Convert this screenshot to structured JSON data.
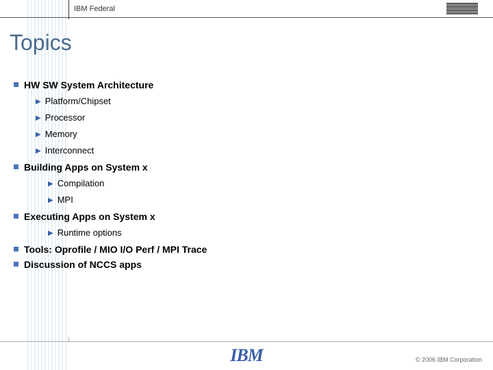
{
  "header": {
    "label": "IBM Federal",
    "logo_alt": "IBM"
  },
  "title": "Topics",
  "topics": [
    {
      "label": "HW SW System Architecture",
      "indent": 1,
      "subs": [
        "Platform/Chipset",
        "Processor",
        "Memory",
        "Interconnect"
      ]
    },
    {
      "label": "Building Apps on System x",
      "indent": 2,
      "subs": [
        "Compilation",
        "MPI"
      ]
    },
    {
      "label": "Executing Apps on System x",
      "indent": 2,
      "subs": [
        "Runtime options"
      ]
    },
    {
      "label": "Tools: Oprofile / MIO I/O Perf / MPI Trace",
      "subs": []
    },
    {
      "label": "Discussion of NCCS apps",
      "subs": []
    }
  ],
  "footer": {
    "logo": "IBM",
    "copyright": "© 2006 IBM Corporation"
  }
}
